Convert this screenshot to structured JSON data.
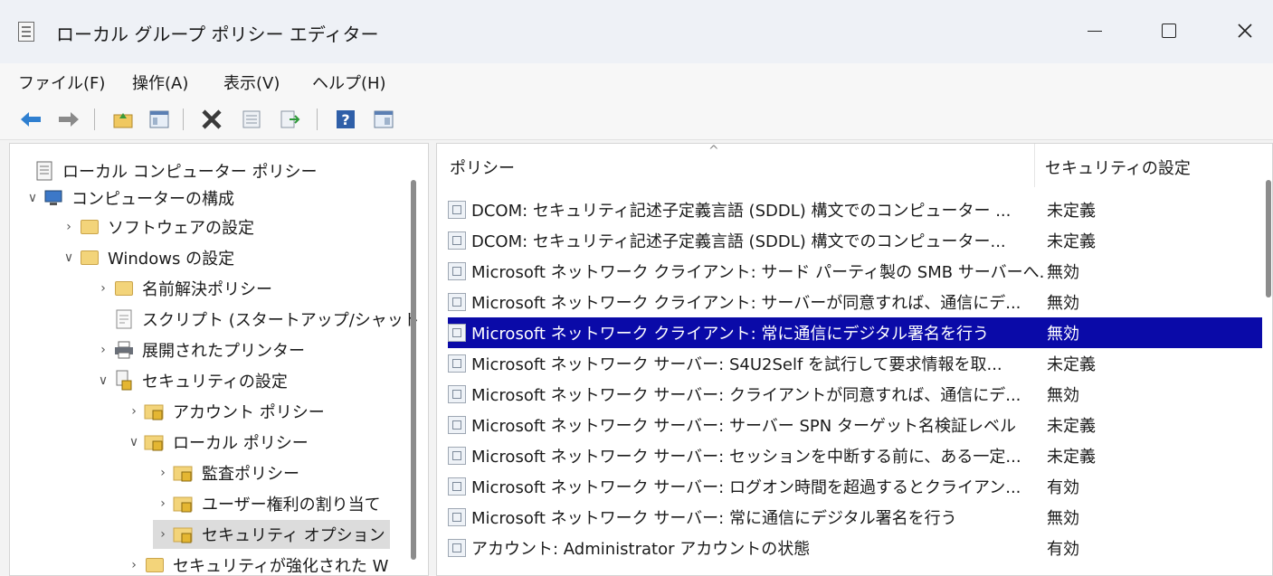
{
  "window": {
    "title": "ローカル グループ ポリシー エディター",
    "controls": {
      "minimize": "—",
      "maximize": "☐",
      "close": "✕"
    }
  },
  "menu": [
    "ファイル(F)",
    "操作(A)",
    "表示(V)",
    "ヘルプ(H)"
  ],
  "toolbar": {
    "icons": [
      "back-arrow-icon",
      "forward-arrow-icon",
      "up-folder-icon",
      "show-hide-tree-icon",
      "delete-icon",
      "properties-icon",
      "export-list-icon",
      "help-icon",
      "extended-view-icon"
    ]
  },
  "tree": {
    "items": [
      {
        "label": "ローカル コンピューター ポリシー",
        "expander": "",
        "icon": "policy-doc-icon"
      },
      {
        "label": "コンピューターの構成",
        "expander": "v",
        "icon": "computer-icon"
      },
      {
        "label": "ソフトウェアの設定",
        "expander": ">",
        "icon": "folder-icon"
      },
      {
        "label": "Windows の設定",
        "expander": "v",
        "icon": "folder-icon"
      },
      {
        "label": "名前解決ポリシー",
        "expander": ">",
        "icon": "folder-icon"
      },
      {
        "label": "スクリプト (スタートアップ/シャット",
        "expander": "",
        "icon": "script-icon"
      },
      {
        "label": "展開されたプリンター",
        "expander": ">",
        "icon": "printer-icon"
      },
      {
        "label": "セキュリティの設定",
        "expander": "v",
        "icon": "security-settings-icon"
      },
      {
        "label": "アカウント ポリシー",
        "expander": ">",
        "icon": "security-folder-icon"
      },
      {
        "label": "ローカル ポリシー",
        "expander": "v",
        "icon": "security-folder-icon"
      },
      {
        "label": "監査ポリシー",
        "expander": ">",
        "icon": "security-folder-icon"
      },
      {
        "label": "ユーザー権利の割り当て",
        "expander": ">",
        "icon": "security-folder-icon"
      },
      {
        "label": "セキュリティ オプション",
        "expander": ">",
        "icon": "security-folder-icon"
      },
      {
        "label": "セキュリティが強化された W",
        "expander": ">",
        "icon": "folder-icon"
      }
    ]
  },
  "list": {
    "columns": {
      "policy": "ポリシー",
      "setting": "セキュリティの設定",
      "sort_indicator": "^"
    },
    "rows": [
      {
        "policy": "DCOM: セキュリティ記述子定義言語 (SDDL) 構文でのコンピューター ...",
        "setting": "未定義"
      },
      {
        "policy": "DCOM: セキュリティ記述子定義言語 (SDDL) 構文でのコンピューター...",
        "setting": "未定義"
      },
      {
        "policy": "Microsoft ネットワーク クライアント: サード パーティ製の SMB サーバーへ...",
        "setting": "無効"
      },
      {
        "policy": "Microsoft ネットワーク クライアント: サーバーが同意すれば、通信にデ...",
        "setting": "無効"
      },
      {
        "policy": "Microsoft ネットワーク クライアント: 常に通信にデジタル署名を行う",
        "setting": "無効"
      },
      {
        "policy": "Microsoft ネットワーク サーバー: S4U2Self を試行して要求情報を取...",
        "setting": "未定義"
      },
      {
        "policy": "Microsoft ネットワーク サーバー: クライアントが同意すれば、通信にデ...",
        "setting": "無効"
      },
      {
        "policy": "Microsoft ネットワーク サーバー: サーバー SPN ターゲット名検証レベル",
        "setting": "未定義"
      },
      {
        "policy": "Microsoft ネットワーク サーバー: セッションを中断する前に、ある一定...",
        "setting": "未定義"
      },
      {
        "policy": "Microsoft ネットワーク サーバー: ログオン時間を超過するとクライアン...",
        "setting": "有効"
      },
      {
        "policy": "Microsoft ネットワーク サーバー: 常に通信にデジタル署名を行う",
        "setting": "無効"
      },
      {
        "policy": "アカウント: Administrator アカウントの状態",
        "setting": "有効"
      }
    ]
  }
}
